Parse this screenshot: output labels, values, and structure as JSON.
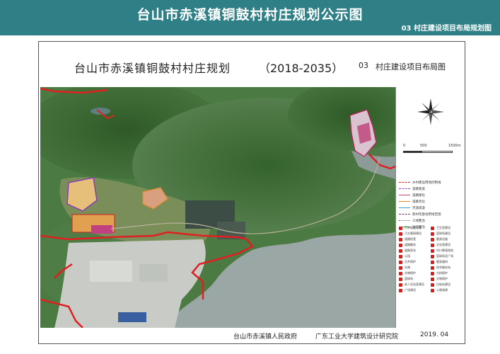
{
  "banner": {
    "title": "台山市赤溪镇铜鼓村村庄规划公示图",
    "subtitle": "03 村庄建设项目布局规划图"
  },
  "sheet": {
    "title": "台山市赤溪镇铜鼓村村庄规划",
    "period": "（2018-2035）",
    "code": "03",
    "name": "村庄建设项目布局图"
  },
  "scale": {
    "labels": [
      "0",
      "500",
      "1500m"
    ]
  },
  "legend_lines": [
    {
      "label": "乡村建设用地控制线",
      "color": "#cc2222",
      "style": "dashed"
    },
    {
      "label": "道路拓宽",
      "color": "#8a3fb0",
      "style": "dashed"
    },
    {
      "label": "道路硬化",
      "color": "#c04080",
      "style": "solid"
    },
    {
      "label": "道路亮化",
      "color": "#e08a2a",
      "style": "solid"
    },
    {
      "label": "河道疏浚",
      "color": "#3aa0d0",
      "style": "solid"
    },
    {
      "label": "新村宅基地用地范围",
      "color": "#7a2a7a",
      "style": "dashed"
    },
    {
      "label": "三线整治",
      "color": "#d04040",
      "style": "dotted"
    },
    {
      "label": "边沟整治",
      "color": "#40a040",
      "style": "solid"
    }
  ],
  "legend_items": [
    "污水处理设施",
    "卫生室建设",
    "污水管网建设",
    "篮球场建设",
    "道路拓宽",
    "健身设施",
    "道路硬化",
    "文化室建设",
    "道路亮化",
    "村口景观改造",
    "公园",
    "篮球场及广场",
    "古井保护",
    "健身器材",
    "水闸",
    "综合服务站",
    "文物保护",
    "古树保护",
    "篮球场",
    "文物保护",
    "老人活动室建设",
    "垃圾站建设",
    "广场建设",
    "公厕改建"
  ],
  "footer": {
    "left": "台山市赤溪镇人民政府",
    "center": "广东工业大学建筑设计研究院",
    "date": "2019. 04"
  },
  "colors": {
    "banner": "#2f7f86",
    "boundary": "#e02020",
    "sea": "#9aa7a4",
    "forest": "#3f6e35"
  }
}
